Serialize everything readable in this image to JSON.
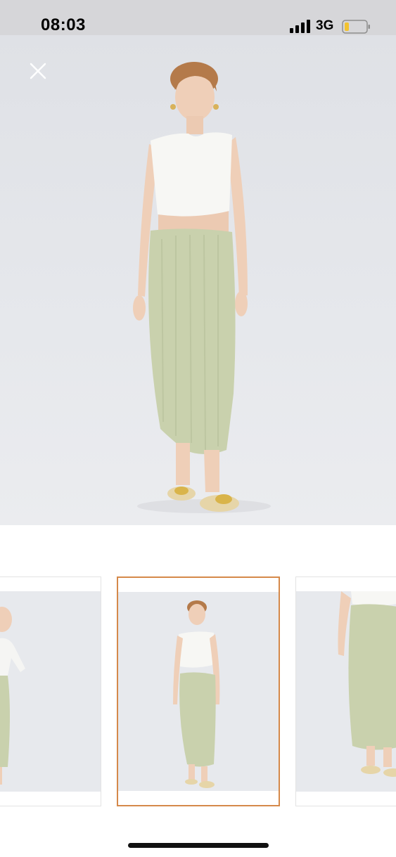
{
  "status_bar": {
    "time": "08:03",
    "network": "3G",
    "icons": [
      "signal-bars-icon",
      "battery-icon"
    ],
    "battery_fill_color": "#f2c230"
  },
  "gallery": {
    "close_icon": "close-icon",
    "selected_index": 1,
    "thumbnail_count": 3,
    "selected_border_color": "#d5894a"
  },
  "colors": {
    "skirt": "#c9d1ad",
    "top": "#f7f7f4",
    "background": "#e3e5e9"
  }
}
